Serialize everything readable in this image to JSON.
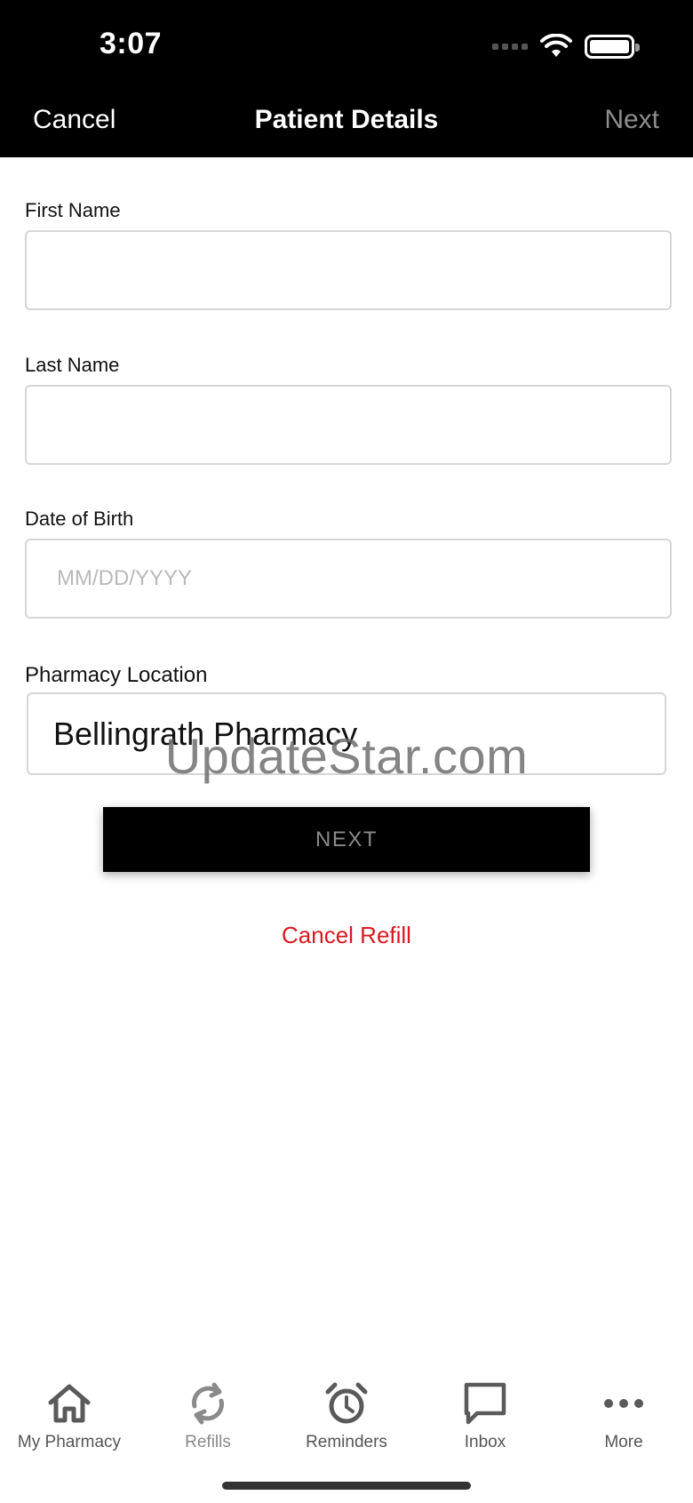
{
  "status_bar": {
    "time": "3:07"
  },
  "nav": {
    "cancel_label": "Cancel",
    "title": "Patient Details",
    "next_label": "Next"
  },
  "form": {
    "first_name": {
      "label": "First Name",
      "value": "",
      "placeholder": ""
    },
    "last_name": {
      "label": "Last Name",
      "value": "",
      "placeholder": ""
    },
    "dob": {
      "label": "Date of Birth",
      "value": "",
      "placeholder": "MM/DD/YYYY"
    },
    "pharmacy": {
      "label": "Pharmacy Location",
      "value": "Bellingrath Pharmacy"
    }
  },
  "watermark": "UpdateStar.com",
  "actions": {
    "next_label": "NEXT",
    "cancel_refill_label": "Cancel Refill"
  },
  "tabs": [
    {
      "label": "My Pharmacy",
      "icon": "home-icon"
    },
    {
      "label": "Refills",
      "icon": "refresh-icon"
    },
    {
      "label": "Reminders",
      "icon": "alarm-clock-icon"
    },
    {
      "label": "Inbox",
      "icon": "chat-bubble-icon"
    },
    {
      "label": "More",
      "icon": "more-dots-icon"
    }
  ],
  "colors": {
    "header_bg": "#000000",
    "danger": "#d71920",
    "disabled_text": "#8e8e8e",
    "field_border": "#d6d6d6"
  }
}
